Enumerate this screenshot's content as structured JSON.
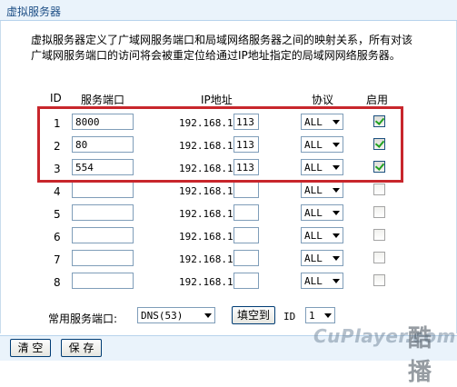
{
  "title": "虚拟服务器",
  "description": "虚拟服务器定义了广域网服务端口和局域网络服务器之间的映射关系，所有对该广域网服务端口的访问将会被重定位给通过IP地址指定的局域网网络服务器。",
  "headers": {
    "id": "ID",
    "service_port": "服务端口",
    "ip_address": "IP地址",
    "protocol": "协议",
    "enabled": "启用"
  },
  "rows": [
    {
      "id": "1",
      "port": "8000",
      "ip_prefix": "192.168.1.",
      "ip_last": "113",
      "protocol": "ALL",
      "enabled": true
    },
    {
      "id": "2",
      "port": "80",
      "ip_prefix": "192.168.1.",
      "ip_last": "113",
      "protocol": "ALL",
      "enabled": true
    },
    {
      "id": "3",
      "port": "554",
      "ip_prefix": "192.168.1.",
      "ip_last": "113",
      "protocol": "ALL",
      "enabled": true
    },
    {
      "id": "4",
      "port": "",
      "ip_prefix": "192.168.1.",
      "ip_last": "",
      "protocol": "ALL",
      "enabled": false
    },
    {
      "id": "5",
      "port": "",
      "ip_prefix": "192.168.1.",
      "ip_last": "",
      "protocol": "ALL",
      "enabled": false
    },
    {
      "id": "6",
      "port": "",
      "ip_prefix": "192.168.1.",
      "ip_last": "",
      "protocol": "ALL",
      "enabled": false
    },
    {
      "id": "7",
      "port": "",
      "ip_prefix": "192.168.1.",
      "ip_last": "",
      "protocol": "ALL",
      "enabled": false
    },
    {
      "id": "8",
      "port": "",
      "ip_prefix": "192.168.1.",
      "ip_last": "",
      "protocol": "ALL",
      "enabled": false
    }
  ],
  "common": {
    "label": "常用服务端口:",
    "selected": "DNS(53)",
    "fill_button": "填空到",
    "id_label": "ID",
    "id_selected": "1"
  },
  "footer": {
    "clear_button": "清 空",
    "save_button": "保 存"
  },
  "watermark": {
    "latin": "CuPlayer.com",
    "cjk": "酷播"
  },
  "colors": {
    "highlight_border": "#c8262c",
    "title_text": "#1e4f86",
    "header_bg": "#eaf3fb"
  }
}
